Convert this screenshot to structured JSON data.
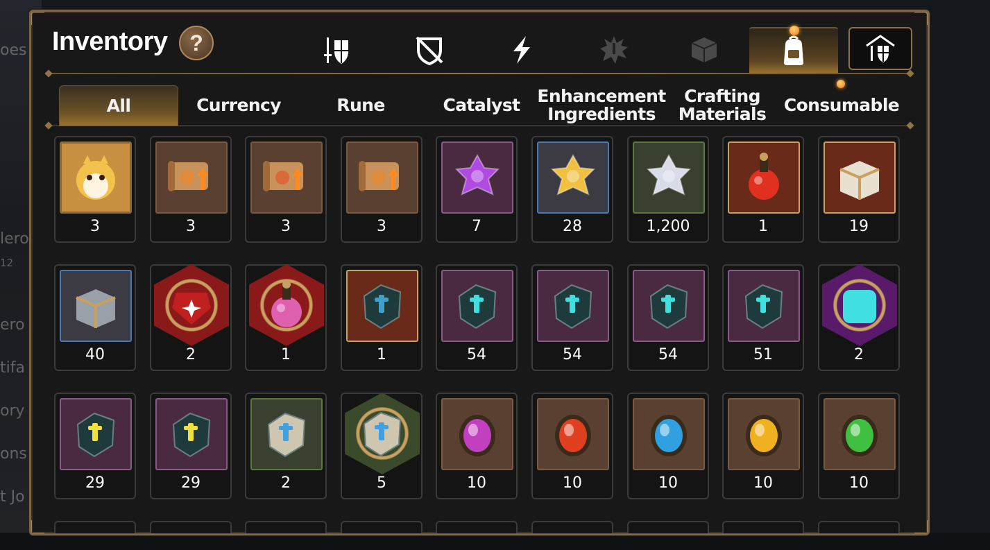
{
  "panel": {
    "title": "Inventory",
    "help_label": "?"
  },
  "background": {
    "left_fragments": [
      "oes",
      "lero",
      "12",
      "ero J",
      "tifa",
      "ory",
      "ons",
      "t Jo"
    ]
  },
  "top_categories": [
    {
      "name": "equipment-icon",
      "active": false
    },
    {
      "name": "broken-shield-icon",
      "active": false
    },
    {
      "name": "lightning-icon",
      "active": false
    },
    {
      "name": "splash-mark-icon",
      "active": false
    },
    {
      "name": "cube-icon",
      "active": false
    },
    {
      "name": "backpack-icon",
      "active": true
    },
    {
      "name": "storage-house-icon",
      "active": false
    }
  ],
  "sub_tabs": [
    {
      "label": "All",
      "active": true
    },
    {
      "label": "Currency",
      "active": false
    },
    {
      "label": "Rune",
      "active": false
    },
    {
      "label": "Catalyst",
      "active": false
    },
    {
      "label": "Enhancement Ingredients",
      "active": false
    },
    {
      "label": "Crafting Materials",
      "active": false
    },
    {
      "label": "Consumable",
      "active": false
    }
  ],
  "items": [
    {
      "icon": "yellow-creature-icon",
      "count": "3",
      "frame": "circle",
      "color": "#f2c24a"
    },
    {
      "icon": "scroll-orange-arrow-icon",
      "count": "3",
      "frame": "brown",
      "color": "#e08a3a"
    },
    {
      "icon": "scroll-rainbow-cube-icon",
      "count": "3",
      "frame": "brown",
      "color": "#d86a3a"
    },
    {
      "icon": "scroll-orange-arrow-icon",
      "count": "3",
      "frame": "brown",
      "color": "#e08a3a"
    },
    {
      "icon": "purple-crystal-flower-icon",
      "count": "7",
      "frame": "purple",
      "color": "#b04ae0"
    },
    {
      "icon": "gold-crystal-flower-icon",
      "count": "28",
      "frame": "blue",
      "color": "#f0c040"
    },
    {
      "icon": "silver-crystal-flower-icon",
      "count": "1,200",
      "frame": "green",
      "color": "#d8dce8"
    },
    {
      "icon": "red-potion-flask-icon",
      "count": "1",
      "frame": "gold",
      "color": "#e03020"
    },
    {
      "icon": "white-gold-chest-icon",
      "count": "19",
      "frame": "gold",
      "color": "#e8e0d0"
    },
    {
      "icon": "silver-chest-icon",
      "count": "40",
      "frame": "blue",
      "color": "#9aa0a8"
    },
    {
      "icon": "red-gem-hex-icon",
      "count": "2",
      "frame": "hexred",
      "color": "#c02020"
    },
    {
      "icon": "pink-potion-hex-icon",
      "count": "1",
      "frame": "hexred",
      "color": "#e060b0"
    },
    {
      "icon": "blue-hammer-stone-icon",
      "count": "1",
      "frame": "gold",
      "color": "#40a0c8"
    },
    {
      "icon": "sword-rune-stone-icon",
      "count": "54",
      "frame": "purple",
      "color": "#40e0e0"
    },
    {
      "icon": "helmet-rune-stone-icon",
      "count": "54",
      "frame": "purple",
      "color": "#40e0e0"
    },
    {
      "icon": "armor-rune-stone-icon",
      "count": "54",
      "frame": "purple",
      "color": "#40e0e0"
    },
    {
      "icon": "boot-rune-stone-icon",
      "count": "51",
      "frame": "purple",
      "color": "#40e0e0"
    },
    {
      "icon": "star-rune-hex-icon",
      "count": "2",
      "frame": "hexpurple",
      "color": "#40e0e0"
    },
    {
      "icon": "yellow-hammer-stone-icon",
      "count": "29",
      "frame": "purple",
      "color": "#f0e040"
    },
    {
      "icon": "yellow-bolt-stone-icon",
      "count": "29",
      "frame": "purple",
      "color": "#f0e040"
    },
    {
      "icon": "blue-sword-pale-stone-icon",
      "count": "2",
      "frame": "green",
      "color": "#40a0e0"
    },
    {
      "icon": "blue-star-pale-stone-hex-icon",
      "count": "5",
      "frame": "hexgreen",
      "color": "#40a0e0"
    },
    {
      "icon": "purple-moon-orb-icon",
      "count": "10",
      "frame": "brown",
      "color": "#c040c0"
    },
    {
      "icon": "red-fire-orb-icon",
      "count": "10",
      "frame": "brown",
      "color": "#e04020"
    },
    {
      "icon": "blue-ice-orb-icon",
      "count": "10",
      "frame": "brown",
      "color": "#30a0e0"
    },
    {
      "icon": "gold-star-orb-icon",
      "count": "10",
      "frame": "brown",
      "color": "#f0b020"
    },
    {
      "icon": "green-leaf-orb-icon",
      "count": "10",
      "frame": "brown",
      "color": "#40c040"
    }
  ]
}
